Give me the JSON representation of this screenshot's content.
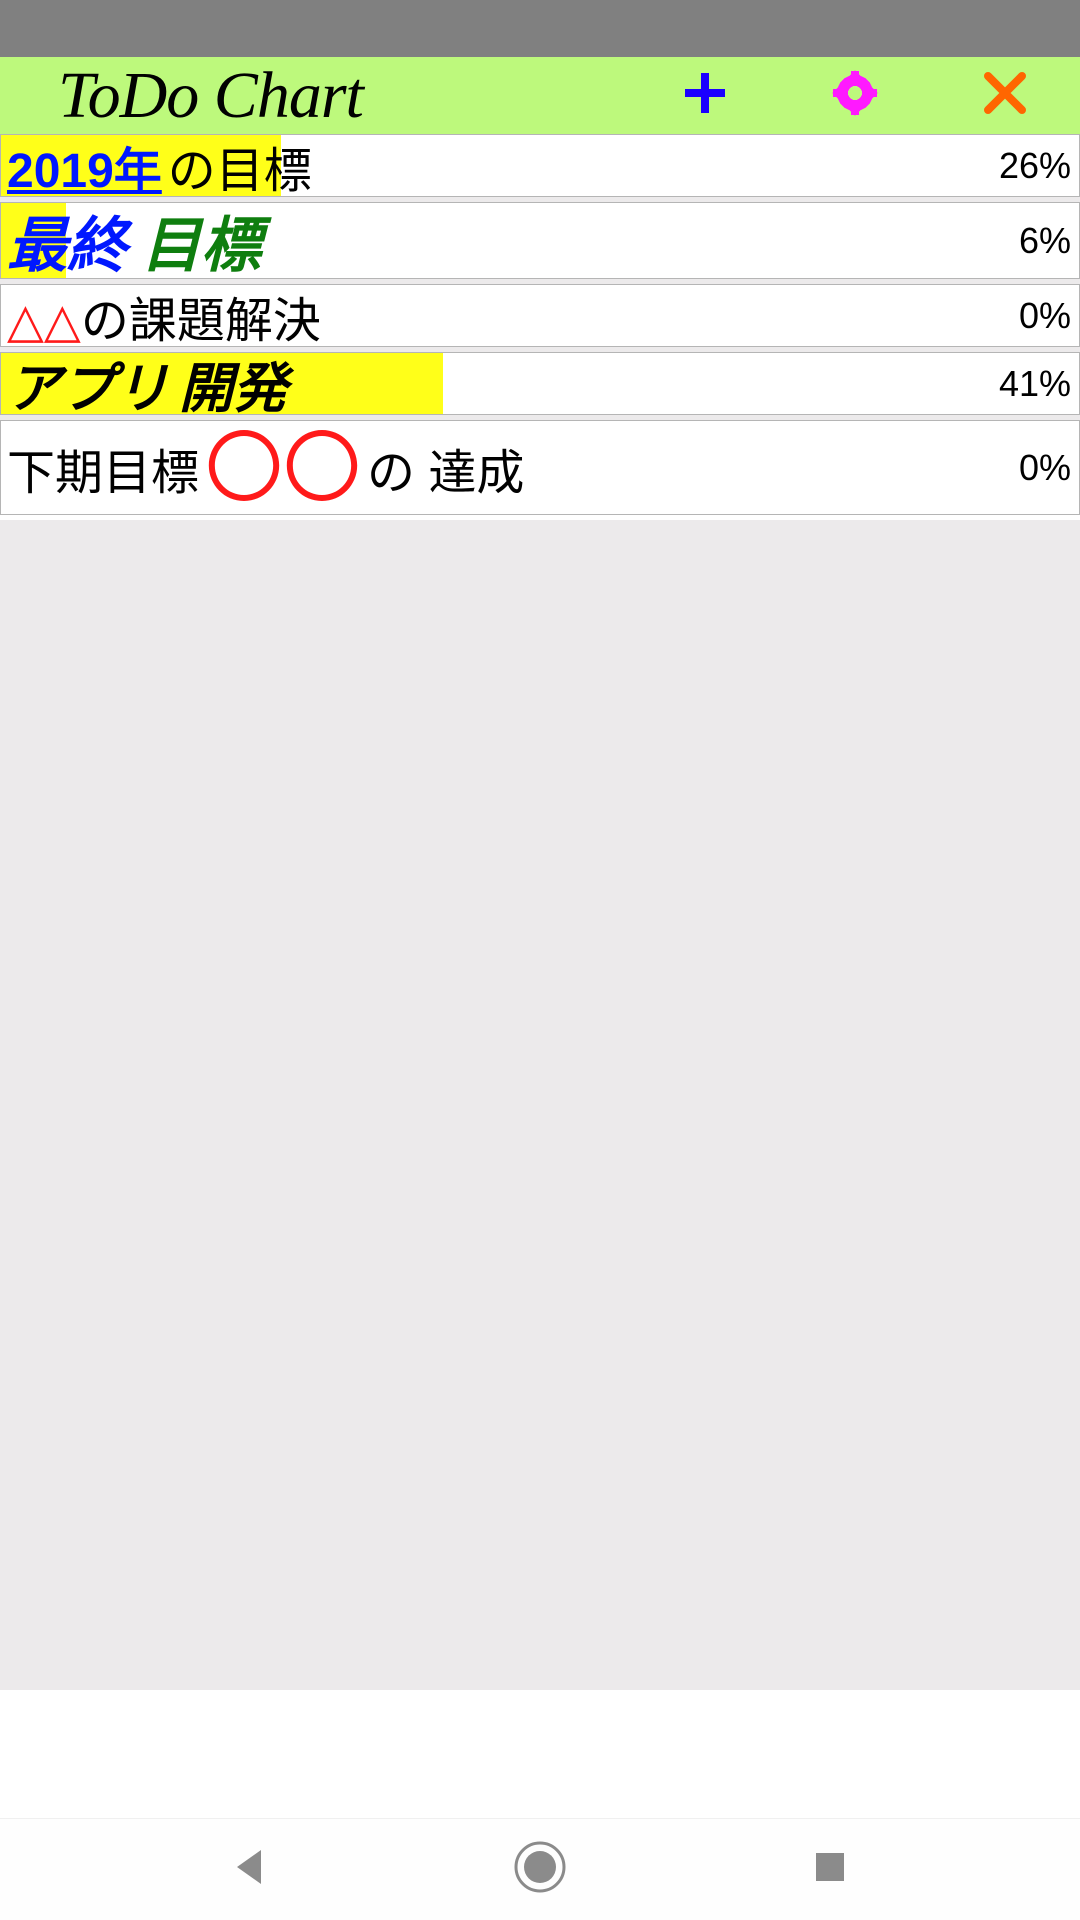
{
  "app": {
    "title": "ToDo Chart"
  },
  "toolbar": {
    "add_icon": "plus-icon",
    "settings_icon": "gear-icon",
    "close_icon": "close-icon"
  },
  "items": [
    {
      "segments": {
        "a": "2019年",
        "b": "の目標"
      },
      "percent_label": "26%",
      "percent_value": 26
    },
    {
      "segments": {
        "a": "最終",
        "b": "目標"
      },
      "percent_label": "6%",
      "percent_value": 6
    },
    {
      "segments": {
        "a": "△△",
        "b": "の課題解決"
      },
      "percent_label": "0%",
      "percent_value": 0
    },
    {
      "segments": {
        "a": "アプリ",
        "b": "開発"
      },
      "percent_label": "41%",
      "percent_value": 41
    },
    {
      "segments": {
        "a": "下期目標 ",
        "b": "〇〇",
        "c": "の 達成"
      },
      "percent_label": "0%",
      "percent_value": 0
    }
  ],
  "colors": {
    "appbar_bg": "#bdf97c",
    "highlight": "#ffff19",
    "plus": "#1a00ff",
    "gear": "#ff19ff",
    "close": "#ff6600"
  }
}
